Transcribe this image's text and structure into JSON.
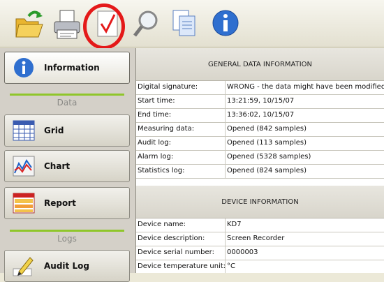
{
  "toolbar": {
    "buttons": [
      "open-icon",
      "print-icon",
      "verify-icon",
      "search-icon",
      "copy-icon",
      "info-icon"
    ]
  },
  "sidebar": {
    "information": "Information",
    "data_section": "Data",
    "grid": "Grid",
    "chart": "Chart",
    "report": "Report",
    "logs_section": "Logs",
    "audit_log": "Audit Log"
  },
  "general": {
    "title": "GENERAL DATA INFORMATION",
    "rows": [
      {
        "k": "Digital signature:",
        "v": "WRONG - the data might have been modified o"
      },
      {
        "k": "Start time:",
        "v": "13:21:59, 10/15/07"
      },
      {
        "k": "End time:",
        "v": "13:36:02, 10/15/07"
      },
      {
        "k": "Measuring data:",
        "v": "Opened (842 samples)"
      },
      {
        "k": "Audit log:",
        "v": "Opened (113 samples)"
      },
      {
        "k": "Alarm log:",
        "v": "Opened (5328 samples)"
      },
      {
        "k": "Statistics log:",
        "v": "Opened (824 samples)"
      }
    ]
  },
  "device": {
    "title": "DEVICE INFORMATION",
    "rows": [
      {
        "k": "Device name:",
        "v": "KD7"
      },
      {
        "k": "Device description:",
        "v": "Screen Recorder"
      },
      {
        "k": "Device serial number:",
        "v": "0000003"
      },
      {
        "k": "Device temperature unit:",
        "v": "°C"
      }
    ]
  },
  "colors": {
    "highlight": "#e41919",
    "accent": "#8fc62b"
  }
}
